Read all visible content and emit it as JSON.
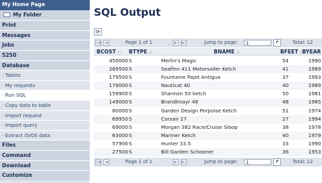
{
  "sidebar": {
    "home": "My Home Page",
    "folder": "My Folder",
    "items": [
      {
        "label": "Print",
        "kind": "section"
      },
      {
        "label": "Messages",
        "kind": "section"
      },
      {
        "label": "Jobs",
        "kind": "section"
      },
      {
        "label": "5250",
        "kind": "section"
      },
      {
        "label": "Database",
        "kind": "section"
      },
      {
        "label": "· Tables",
        "kind": "item"
      },
      {
        "label": "· My requests",
        "kind": "item"
      },
      {
        "label": "· Run SQL",
        "kind": "item",
        "selected": true
      },
      {
        "label": "· Copy data to table",
        "kind": "item"
      },
      {
        "label": "· Import request",
        "kind": "item"
      },
      {
        "label": "· Import query",
        "kind": "item"
      },
      {
        "label": "· Extract i5/OS data",
        "kind": "item"
      },
      {
        "label": "Files",
        "kind": "section"
      },
      {
        "label": "Command",
        "kind": "section"
      },
      {
        "label": "Download",
        "kind": "section"
      },
      {
        "label": "Customize",
        "kind": "section"
      }
    ]
  },
  "main": {
    "title": "SQL Output",
    "refresh_icon": "⟳",
    "pager": {
      "page_text": "Page 1 of 1",
      "jump_label": "Jump to page:",
      "jump_value": "1",
      "go_icon": "↱",
      "total": "Total: 12"
    },
    "columns": [
      "BCOST",
      "BTYPE",
      "BNAME",
      "BFEET",
      "BYEAR"
    ],
    "sort_icon": "◇",
    "rows": [
      {
        "bcost": "450000",
        "btype": "S",
        "bname": "Merlin's Magic",
        "bfeet": "54",
        "byear": "1990"
      },
      {
        "bcost": "269500",
        "btype": "S",
        "bname": "Seafinn 411 Motorsailer Ketch",
        "bfeet": "41",
        "byear": "1989"
      },
      {
        "bcost": "179500",
        "btype": "S",
        "bname": "Fountaine Pajot Antigua",
        "bfeet": "37",
        "byear": "1993"
      },
      {
        "bcost": "179000",
        "btype": "S",
        "bname": "Nauticat 40",
        "bfeet": "40",
        "byear": "1989"
      },
      {
        "bcost": "159900",
        "btype": "S",
        "bname": "Shannon 50 ketch",
        "bfeet": "50",
        "byear": "1981"
      },
      {
        "bcost": "149000",
        "btype": "S",
        "bname": "Brandlmayr 48",
        "bfeet": "48",
        "byear": "1985"
      },
      {
        "bcost": "80000",
        "btype": "S",
        "bname": "Garden Design Porpoise Ketch",
        "bfeet": "51",
        "byear": "1974"
      },
      {
        "bcost": "69950",
        "btype": "S",
        "bname": "Corsair 27",
        "bfeet": "27",
        "byear": "1994"
      },
      {
        "bcost": "69000",
        "btype": "S",
        "bname": "Morgan 382 Race/Cruise Sloop",
        "bfeet": "38",
        "byear": "1978"
      },
      {
        "bcost": "63000",
        "btype": "S",
        "bname": "Mariner Ketch",
        "bfeet": "40",
        "byear": "1979"
      },
      {
        "bcost": "57900",
        "btype": "S",
        "bname": "Hunter 33.5",
        "bfeet": "33",
        "byear": "1990"
      },
      {
        "bcost": "27500",
        "btype": "S",
        "bname": "Bill Garden Schooner",
        "bfeet": "36",
        "byear": "1953"
      }
    ]
  }
}
